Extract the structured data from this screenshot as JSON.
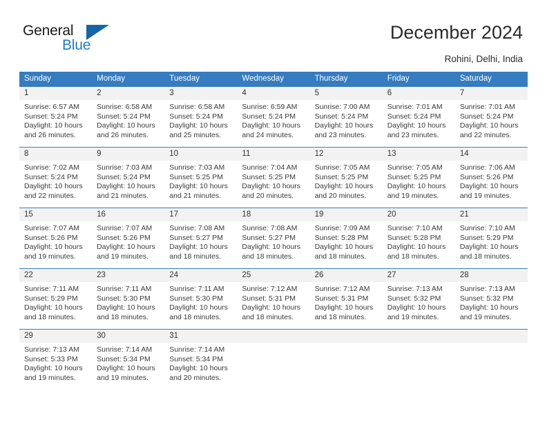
{
  "brand": {
    "name_part1": "General",
    "name_part2": "Blue",
    "triangle_icon": "triangle-icon",
    "accent_color": "#1f7bc4",
    "triangle_color": "#1565a8"
  },
  "header": {
    "title": "December 2024",
    "subtitle": "Rohini, Delhi, India"
  },
  "calendar": {
    "header_bg": "#357cc0",
    "daynum_bg": "#f2f2f2",
    "weekdays": [
      "Sunday",
      "Monday",
      "Tuesday",
      "Wednesday",
      "Thursday",
      "Friday",
      "Saturday"
    ],
    "weeks": [
      [
        {
          "day": "1",
          "sunrise": "Sunrise: 6:57 AM",
          "sunset": "Sunset: 5:24 PM",
          "daylight1": "Daylight: 10 hours",
          "daylight2": "and 26 minutes."
        },
        {
          "day": "2",
          "sunrise": "Sunrise: 6:58 AM",
          "sunset": "Sunset: 5:24 PM",
          "daylight1": "Daylight: 10 hours",
          "daylight2": "and 26 minutes."
        },
        {
          "day": "3",
          "sunrise": "Sunrise: 6:58 AM",
          "sunset": "Sunset: 5:24 PM",
          "daylight1": "Daylight: 10 hours",
          "daylight2": "and 25 minutes."
        },
        {
          "day": "4",
          "sunrise": "Sunrise: 6:59 AM",
          "sunset": "Sunset: 5:24 PM",
          "daylight1": "Daylight: 10 hours",
          "daylight2": "and 24 minutes."
        },
        {
          "day": "5",
          "sunrise": "Sunrise: 7:00 AM",
          "sunset": "Sunset: 5:24 PM",
          "daylight1": "Daylight: 10 hours",
          "daylight2": "and 23 minutes."
        },
        {
          "day": "6",
          "sunrise": "Sunrise: 7:01 AM",
          "sunset": "Sunset: 5:24 PM",
          "daylight1": "Daylight: 10 hours",
          "daylight2": "and 23 minutes."
        },
        {
          "day": "7",
          "sunrise": "Sunrise: 7:01 AM",
          "sunset": "Sunset: 5:24 PM",
          "daylight1": "Daylight: 10 hours",
          "daylight2": "and 22 minutes."
        }
      ],
      [
        {
          "day": "8",
          "sunrise": "Sunrise: 7:02 AM",
          "sunset": "Sunset: 5:24 PM",
          "daylight1": "Daylight: 10 hours",
          "daylight2": "and 22 minutes."
        },
        {
          "day": "9",
          "sunrise": "Sunrise: 7:03 AM",
          "sunset": "Sunset: 5:24 PM",
          "daylight1": "Daylight: 10 hours",
          "daylight2": "and 21 minutes."
        },
        {
          "day": "10",
          "sunrise": "Sunrise: 7:03 AM",
          "sunset": "Sunset: 5:25 PM",
          "daylight1": "Daylight: 10 hours",
          "daylight2": "and 21 minutes."
        },
        {
          "day": "11",
          "sunrise": "Sunrise: 7:04 AM",
          "sunset": "Sunset: 5:25 PM",
          "daylight1": "Daylight: 10 hours",
          "daylight2": "and 20 minutes."
        },
        {
          "day": "12",
          "sunrise": "Sunrise: 7:05 AM",
          "sunset": "Sunset: 5:25 PM",
          "daylight1": "Daylight: 10 hours",
          "daylight2": "and 20 minutes."
        },
        {
          "day": "13",
          "sunrise": "Sunrise: 7:05 AM",
          "sunset": "Sunset: 5:25 PM",
          "daylight1": "Daylight: 10 hours",
          "daylight2": "and 19 minutes."
        },
        {
          "day": "14",
          "sunrise": "Sunrise: 7:06 AM",
          "sunset": "Sunset: 5:26 PM",
          "daylight1": "Daylight: 10 hours",
          "daylight2": "and 19 minutes."
        }
      ],
      [
        {
          "day": "15",
          "sunrise": "Sunrise: 7:07 AM",
          "sunset": "Sunset: 5:26 PM",
          "daylight1": "Daylight: 10 hours",
          "daylight2": "and 19 minutes."
        },
        {
          "day": "16",
          "sunrise": "Sunrise: 7:07 AM",
          "sunset": "Sunset: 5:26 PM",
          "daylight1": "Daylight: 10 hours",
          "daylight2": "and 19 minutes."
        },
        {
          "day": "17",
          "sunrise": "Sunrise: 7:08 AM",
          "sunset": "Sunset: 5:27 PM",
          "daylight1": "Daylight: 10 hours",
          "daylight2": "and 18 minutes."
        },
        {
          "day": "18",
          "sunrise": "Sunrise: 7:08 AM",
          "sunset": "Sunset: 5:27 PM",
          "daylight1": "Daylight: 10 hours",
          "daylight2": "and 18 minutes."
        },
        {
          "day": "19",
          "sunrise": "Sunrise: 7:09 AM",
          "sunset": "Sunset: 5:28 PM",
          "daylight1": "Daylight: 10 hours",
          "daylight2": "and 18 minutes."
        },
        {
          "day": "20",
          "sunrise": "Sunrise: 7:10 AM",
          "sunset": "Sunset: 5:28 PM",
          "daylight1": "Daylight: 10 hours",
          "daylight2": "and 18 minutes."
        },
        {
          "day": "21",
          "sunrise": "Sunrise: 7:10 AM",
          "sunset": "Sunset: 5:29 PM",
          "daylight1": "Daylight: 10 hours",
          "daylight2": "and 18 minutes."
        }
      ],
      [
        {
          "day": "22",
          "sunrise": "Sunrise: 7:11 AM",
          "sunset": "Sunset: 5:29 PM",
          "daylight1": "Daylight: 10 hours",
          "daylight2": "and 18 minutes."
        },
        {
          "day": "23",
          "sunrise": "Sunrise: 7:11 AM",
          "sunset": "Sunset: 5:30 PM",
          "daylight1": "Daylight: 10 hours",
          "daylight2": "and 18 minutes."
        },
        {
          "day": "24",
          "sunrise": "Sunrise: 7:11 AM",
          "sunset": "Sunset: 5:30 PM",
          "daylight1": "Daylight: 10 hours",
          "daylight2": "and 18 minutes."
        },
        {
          "day": "25",
          "sunrise": "Sunrise: 7:12 AM",
          "sunset": "Sunset: 5:31 PM",
          "daylight1": "Daylight: 10 hours",
          "daylight2": "and 18 minutes."
        },
        {
          "day": "26",
          "sunrise": "Sunrise: 7:12 AM",
          "sunset": "Sunset: 5:31 PM",
          "daylight1": "Daylight: 10 hours",
          "daylight2": "and 18 minutes."
        },
        {
          "day": "27",
          "sunrise": "Sunrise: 7:13 AM",
          "sunset": "Sunset: 5:32 PM",
          "daylight1": "Daylight: 10 hours",
          "daylight2": "and 19 minutes."
        },
        {
          "day": "28",
          "sunrise": "Sunrise: 7:13 AM",
          "sunset": "Sunset: 5:32 PM",
          "daylight1": "Daylight: 10 hours",
          "daylight2": "and 19 minutes."
        }
      ],
      [
        {
          "day": "29",
          "sunrise": "Sunrise: 7:13 AM",
          "sunset": "Sunset: 5:33 PM",
          "daylight1": "Daylight: 10 hours",
          "daylight2": "and 19 minutes."
        },
        {
          "day": "30",
          "sunrise": "Sunrise: 7:14 AM",
          "sunset": "Sunset: 5:34 PM",
          "daylight1": "Daylight: 10 hours",
          "daylight2": "and 19 minutes."
        },
        {
          "day": "31",
          "sunrise": "Sunrise: 7:14 AM",
          "sunset": "Sunset: 5:34 PM",
          "daylight1": "Daylight: 10 hours",
          "daylight2": "and 20 minutes."
        },
        {
          "day": "",
          "sunrise": "",
          "sunset": "",
          "daylight1": "",
          "daylight2": ""
        },
        {
          "day": "",
          "sunrise": "",
          "sunset": "",
          "daylight1": "",
          "daylight2": ""
        },
        {
          "day": "",
          "sunrise": "",
          "sunset": "",
          "daylight1": "",
          "daylight2": ""
        },
        {
          "day": "",
          "sunrise": "",
          "sunset": "",
          "daylight1": "",
          "daylight2": ""
        }
      ]
    ]
  }
}
